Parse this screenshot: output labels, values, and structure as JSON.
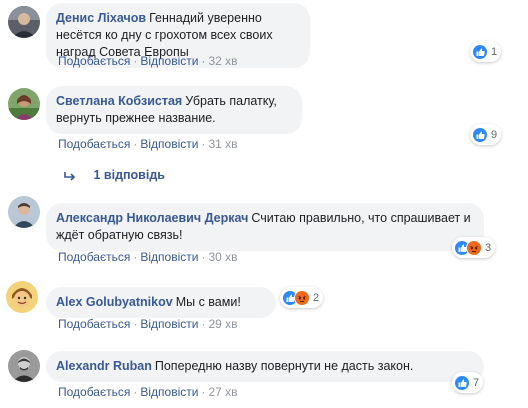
{
  "comments": [
    {
      "author": "Денис Ліхачов",
      "text": "Геннадий уверенно несётся ко дну с грохотом всех своих наград Совета Европы",
      "like_label": "Подобається",
      "reply_label": "Відповісти",
      "time": "32 хв",
      "reaction_count": "1",
      "reactions": [
        "like"
      ]
    },
    {
      "author": "Светлана Кобзистая",
      "text": "Убрать палатку, вернуть прежнее название.",
      "like_label": "Подобається",
      "reply_label": "Відповісти",
      "time": "31 хв",
      "reaction_count": "9",
      "reactions": [
        "like"
      ],
      "replies_label": "1 відповідь"
    },
    {
      "author": "Александр Николаевич Деркач",
      "text": "Считаю правильно, что спрашивает и ждёт обратную связь!",
      "like_label": "Подобається",
      "reply_label": "Відповісти",
      "time": "30 хв",
      "reaction_count": "3",
      "reactions": [
        "like",
        "angry"
      ]
    },
    {
      "author": "Alex Golubyatnikov",
      "text": "Мы с вами!",
      "like_label": "Подобається",
      "reply_label": "Відповісти",
      "time": "29 хв",
      "reaction_count": "2",
      "reactions": [
        "like",
        "angry"
      ]
    },
    {
      "author": "Alexandr Ruban",
      "text": "Попередню назву повернути не дасть закон.",
      "like_label": "Подобається",
      "reply_label": "Відповісти",
      "time": "27 хв",
      "reaction_count": "7",
      "reactions": [
        "like"
      ]
    }
  ],
  "colors": {
    "author": "#385898",
    "bubble": "#f2f3f5",
    "like": "#2d88ff",
    "angry": "#f0681a",
    "meta": "#90949c"
  },
  "icons": {
    "reply_arrow": "reply-arrow-icon",
    "like": "like-icon",
    "angry": "angry-icon"
  }
}
